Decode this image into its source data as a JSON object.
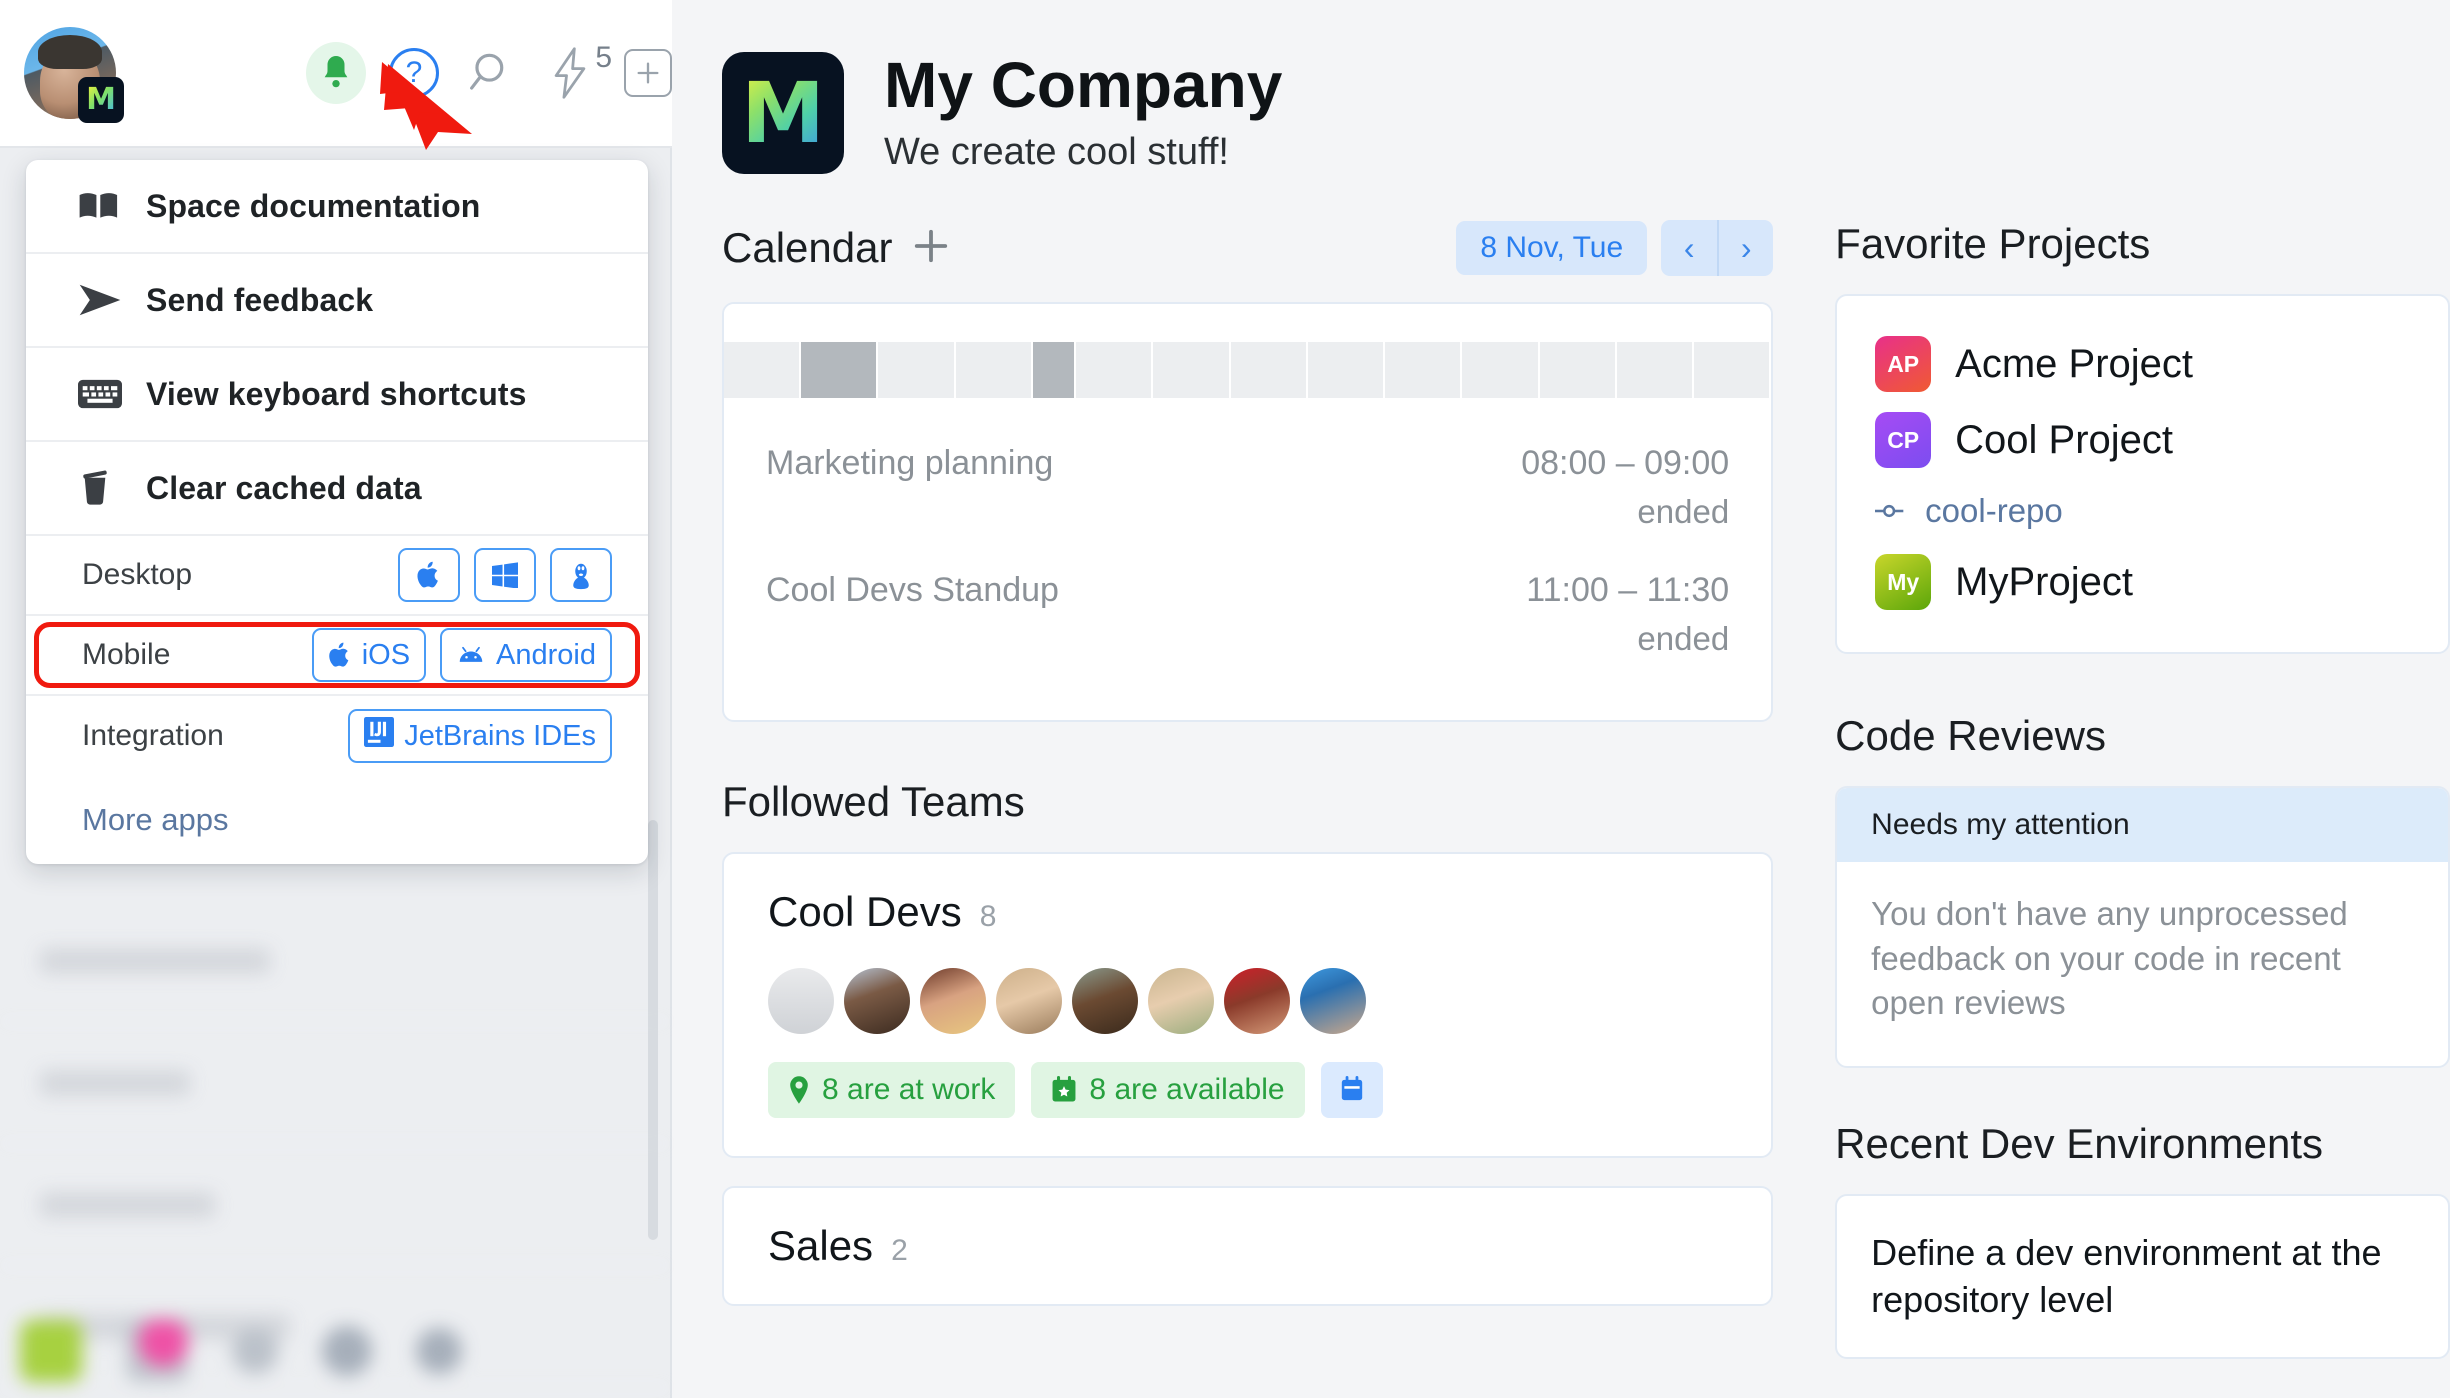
{
  "topbar": {
    "avatar_name": "user-avatar",
    "avatar_badge_letter": "M",
    "bell_icon": "notification-bell-icon",
    "help_icon": "help-question-icon",
    "help_glyph": "?",
    "search_icon": "search-icon",
    "lightning_icon": "lightning-bolt-icon",
    "lightning_badge": "5",
    "plus_icon": "plus-square-icon"
  },
  "menu": {
    "items": [
      {
        "icon": "book-icon",
        "label": "Space documentation"
      },
      {
        "icon": "send-icon",
        "label": "Send feedback"
      },
      {
        "icon": "keyboard-icon",
        "label": "View keyboard shortcuts"
      },
      {
        "icon": "trash-icon",
        "label": "Clear cached data"
      }
    ],
    "platform_rows": [
      {
        "label": "Desktop",
        "highlighted": false,
        "buttons": [
          {
            "icon": "apple-icon",
            "label": ""
          },
          {
            "icon": "windows-icon",
            "label": ""
          },
          {
            "icon": "linux-tux-icon",
            "label": ""
          }
        ]
      },
      {
        "label": "Mobile",
        "highlighted": true,
        "buttons": [
          {
            "icon": "apple-icon",
            "label": "iOS"
          },
          {
            "icon": "android-icon",
            "label": "Android"
          }
        ]
      },
      {
        "label": "Integration",
        "highlighted": false,
        "buttons": [
          {
            "icon": "jetbrains-ij-icon",
            "label": "JetBrains IDEs"
          }
        ]
      }
    ],
    "more_apps_label": "More apps"
  },
  "company": {
    "logo_letter": "M",
    "name": "My Company",
    "tagline": "We create cool stuff!"
  },
  "calendar": {
    "title": "Calendar",
    "add_icon": "plus-icon",
    "date_label": "8 Nov, Tue",
    "prev_glyph": "‹",
    "next_glyph": "›",
    "timeline_cells": 14,
    "timeline_busy_cells": [
      1,
      4
    ],
    "events": [
      {
        "name": "Marketing planning",
        "time": "08:00 – 09:00",
        "status": "ended"
      },
      {
        "name": "Cool Devs Standup",
        "time": "11:00 – 11:30",
        "status": "ended"
      }
    ]
  },
  "followed_teams": {
    "title": "Followed Teams",
    "teams": [
      {
        "name": "Cool Devs",
        "count": "8",
        "member_count": 8,
        "chips": [
          {
            "icon": "location-pin-icon",
            "label": "8 are at work"
          },
          {
            "icon": "calendar-star-icon",
            "label": "8 are available"
          }
        ],
        "action_icon": "calendar-icon"
      },
      {
        "name": "Sales",
        "count": "2",
        "member_count": 0,
        "chips": [],
        "action_icon": ""
      }
    ]
  },
  "favorite_projects": {
    "title": "Favorite Projects",
    "projects": [
      {
        "initials": "AP",
        "name": "Acme Project",
        "color_from": "#e8308a",
        "color_to": "#f05a32"
      },
      {
        "initials": "CP",
        "name": "Cool Project",
        "color_from": "#a64bf4",
        "color_to": "#7c4df0"
      }
    ],
    "repo": {
      "icon": "commit-node-icon",
      "name": "cool-repo"
    },
    "project_last": {
      "initials": "My",
      "name": "MyProject",
      "color_from": "#c9d62b",
      "color_to": "#5ba60a"
    }
  },
  "code_reviews": {
    "title": "Code Reviews",
    "tab_label": "Needs my attention",
    "empty_text": "You don't have any unprocessed feedback on your code in recent open reviews"
  },
  "dev_environments": {
    "title": "Recent Dev Environments",
    "empty_text": "Define a dev environment at the repository level"
  },
  "colors": {
    "accent_blue": "#2a7ff0",
    "link_blue": "#5a77a0",
    "green": "#27a03f",
    "annotation_red": "#f01a0f",
    "page_bg": "#f4f5f7"
  }
}
